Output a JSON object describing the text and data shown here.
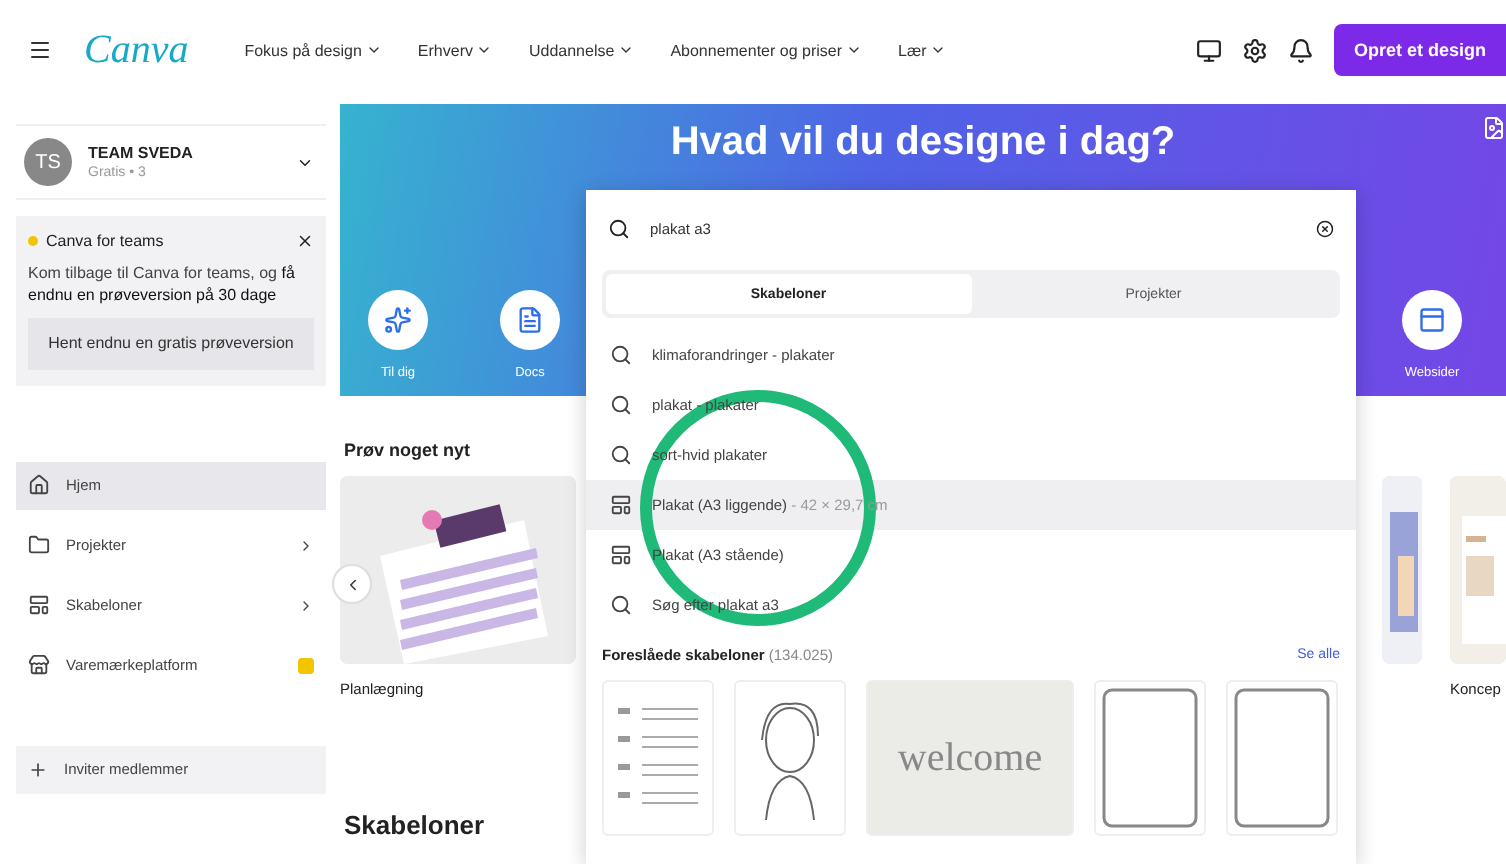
{
  "topbar": {
    "logo": "Canva",
    "nav": [
      {
        "label": "Fokus på design"
      },
      {
        "label": "Erhverv"
      },
      {
        "label": "Uddannelse"
      },
      {
        "label": "Abonnementer og priser"
      },
      {
        "label": "Lær"
      }
    ],
    "create_button": "Opret et design"
  },
  "sidebar": {
    "team": {
      "initials": "TS",
      "name": "TEAM SVEDA",
      "plan": "Gratis • 3"
    },
    "promo": {
      "title": "Canva for teams",
      "text": "Kom tilbage til Canva for teams, og **få endnu en prøveversion på 30 dage**",
      "button": "Hent endnu en gratis prøveversion"
    },
    "nav": [
      {
        "label": "Hjem",
        "kind": "home",
        "selected": true,
        "submenu": false,
        "badge": false
      },
      {
        "label": "Projekter",
        "kind": "folder",
        "selected": false,
        "submenu": true,
        "badge": false
      },
      {
        "label": "Skabeloner",
        "kind": "templates",
        "selected": false,
        "submenu": true,
        "badge": false
      },
      {
        "label": "Varemærkeplatform",
        "kind": "brand",
        "selected": false,
        "submenu": false,
        "badge": true
      }
    ],
    "invite": "Inviter medlemmer"
  },
  "banner": {
    "title": "Hvad vil du designe i dag?",
    "shortcuts_left": [
      {
        "label": "Til dig",
        "kind": "sparkle"
      },
      {
        "label": "Docs",
        "kind": "doc"
      }
    ],
    "shortcuts_right": [
      {
        "label": "Websider",
        "kind": "web"
      }
    ]
  },
  "main": {
    "section_title": "Prøv noget nyt",
    "cards": [
      {
        "label": "Planlægning",
        "kind": "planner"
      },
      {
        "kind": "poster"
      },
      {
        "label": "Koncep",
        "kind": "paper"
      }
    ],
    "templates_title": "Skabeloner"
  },
  "search": {
    "value": "plakat a3",
    "tabs": [
      {
        "label": "Skabeloner",
        "selected": true
      },
      {
        "label": "Projekter",
        "selected": false
      }
    ],
    "suggestions": [
      {
        "kind": "search",
        "text": "klimaforandringer - plakater",
        "selected": false
      },
      {
        "kind": "search",
        "text": "plakat - plakater",
        "selected": false
      },
      {
        "kind": "search",
        "text": "sort-hvid plakater",
        "selected": false
      },
      {
        "kind": "template",
        "text": "Plakat (A3 liggende)",
        "detail": "- 42 × 29,7 cm",
        "selected": true
      },
      {
        "kind": "template",
        "text": "Plakat (A3 stående)",
        "selected": false
      },
      {
        "kind": "search",
        "text": "Søg efter plakat a3",
        "selected": false
      }
    ],
    "suggested_title": "Foreslåede skabeloner",
    "suggested_count": "(134.025)",
    "see_all": "Se alle",
    "thumbnails": [
      {
        "kind": "form"
      },
      {
        "kind": "sketch"
      },
      {
        "kind": "welcome",
        "text": "welcome"
      },
      {
        "kind": "frame"
      },
      {
        "kind": "frame"
      }
    ]
  }
}
